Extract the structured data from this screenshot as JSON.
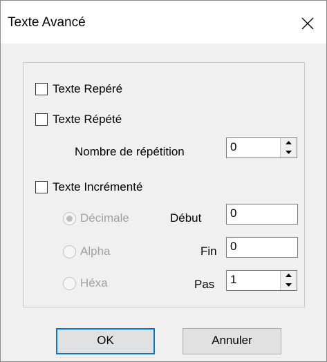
{
  "window": {
    "title": "Texte Avancé"
  },
  "options": {
    "texte_repere": {
      "label": "Texte Repéré",
      "checked": false
    },
    "texte_repete": {
      "label": "Texte Répété",
      "checked": false
    },
    "nombre_repetition": {
      "label": "Nombre de répétition",
      "value": "0"
    },
    "texte_incremente": {
      "label": "Texte Incrémenté",
      "checked": false
    }
  },
  "format": {
    "decimale": {
      "label": "Décimale",
      "selected": true
    },
    "alpha": {
      "label": "Alpha",
      "selected": false
    },
    "hexa": {
      "label": "Héxa",
      "selected": false
    }
  },
  "range": {
    "debut": {
      "label": "Début",
      "value": "0"
    },
    "fin": {
      "label": "Fin",
      "value": "0"
    },
    "pas": {
      "label": "Pas",
      "value": "1"
    }
  },
  "buttons": {
    "ok": "OK",
    "cancel": "Annuler"
  },
  "icons": {
    "close": "close-icon",
    "spin_up": "spin-up-icon",
    "spin_down": "spin-down-icon"
  },
  "colors": {
    "disabled_text": "#a0a0a0",
    "default_button_border": "#0078d7"
  }
}
